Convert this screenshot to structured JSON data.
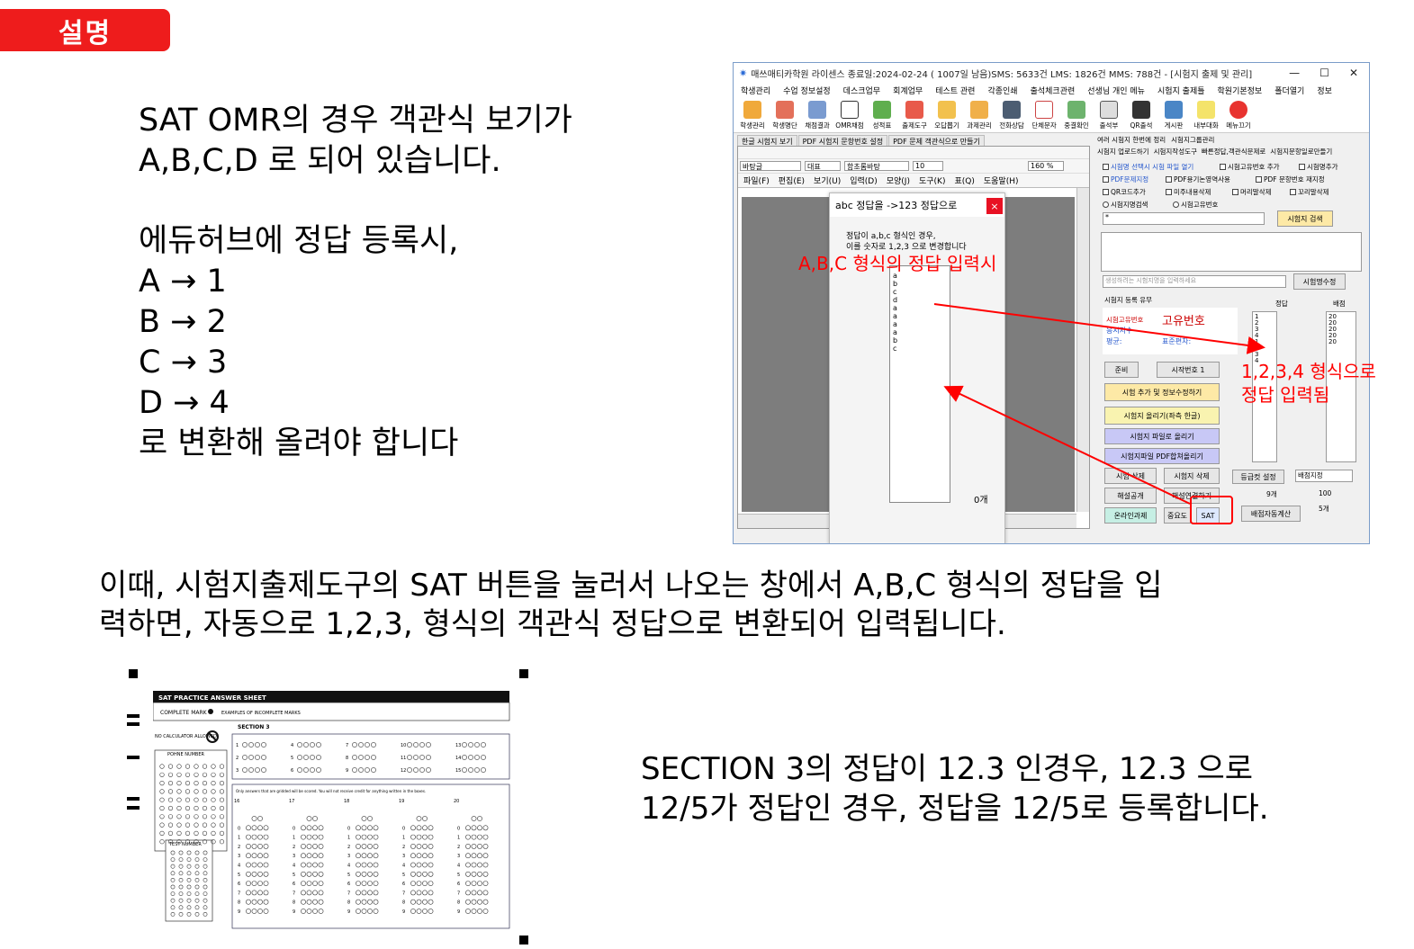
{
  "badge": "설명",
  "intro": {
    "line1": "SAT OMR의 경우 객관식 보기가",
    "line2": "A,B,C,D 로 되어 있습니다."
  },
  "mapping": {
    "line1": "에듀허브에 정답 등록시,",
    "a": "A → 1",
    "b": "B → 2",
    "c": "C → 3",
    "d": "D → 4",
    "line_end": "로 변환해 올려야 합니다"
  },
  "middle": {
    "line1": "이때, 시험지출제도구의 SAT 버튼을 눌러서 나오는 창에서 A,B,C 형식의 정답을 입",
    "line2": "력하면, 자동으로 1,2,3, 형식의 객관식 정답으로 변환되어 입력됩니다."
  },
  "section3": {
    "line1": "SECTION 3의 정답이 12.3 인경우, 12.3 으로",
    "line2": "12/5가 정답인 경우, 정답을 12/5로 등록합니다."
  },
  "annotations": {
    "abc_input": "A,B,C 형식의 정답 입력시",
    "num_input_1": "1,2,3,4 형식으로",
    "num_input_2": "정답 입력됨"
  },
  "window": {
    "title": "매쓰매티카학원  라이센스 종료일:2024-02-24 ( 1007일 남음)SMS: 5633건 LMS: 1826건 MMS: 788건  - [시험지 출제 및 관리]",
    "controls": [
      "—",
      "☐",
      "✕"
    ],
    "menu": [
      "학생관리",
      "수업 정보설정",
      "데스크업무",
      "회계업무",
      "테스트 관련",
      "각종인쇄",
      "출석체크관련",
      "선생님 개인 메뉴",
      "시험지 출제틀",
      "학원기본정보",
      "폴더열기",
      "정보"
    ],
    "toolbar": [
      "학생관리",
      "학생명단",
      "채점결과",
      "OMR채점",
      "성적표",
      "출제도구",
      "오답뽑기",
      "과제관리",
      "전화상담",
      "단체문자",
      "중결확인",
      "출석부",
      "QR출석",
      "게시판",
      "내부대화",
      "메뉴끄기"
    ],
    "doc_tabs": [
      "한글 시험지 보기",
      "PDF 시험지 문항번호 설정",
      "PDF 문제 객관식으로 만들기"
    ],
    "editor": {
      "style": "바탕글",
      "type": "대표",
      "font": "함초롬바탕",
      "size": "10",
      "zoom": "160 %",
      "menu": [
        "파일(F)",
        "편집(E)",
        "보기(U)",
        "입력(D)",
        "모양(J)",
        "도구(K)",
        "표(Q)",
        "도움말(H)"
      ]
    },
    "dialog": {
      "title": "abc 정답을 ->123 정답으로",
      "close": "×",
      "note1": "정답이 a,b,c 형식인 경우,",
      "note2": "이를 숫자로 1,2,3 으로 변경합니다",
      "answers": [
        "a",
        "b",
        "c",
        "d",
        "a",
        "a",
        "a",
        "a",
        "b",
        "c"
      ],
      "count": "0개"
    },
    "right": {
      "tabs1": [
        "여러 시험지 한번에 정리",
        "시험지그룹관리"
      ],
      "tabs2": [
        "시험지 업로드하기",
        "시험지작성도구",
        "빠른정답,객관식문제로",
        "시험지문항일로만들기"
      ],
      "checks": [
        "시험명 선택시 시험 파일 열기",
        "시험고유번호 추가",
        "시험명추가",
        "PDF문제지정",
        "PDF용기논영역사용",
        "PDF 문항번호 재지정",
        "QR코드추가",
        "미주내용삭제",
        "머리말삭제",
        "꼬리말삭제"
      ],
      "radios": [
        "시험지명검색",
        "시험고유번호"
      ],
      "search_btn": "시험지 검색",
      "search_value": "*",
      "name_placeholder": "생성하려는 시험지명을 입력하세요",
      "rename_btn": "시험명수정",
      "reg_label": "시험지 등록 유무",
      "answer_label": "정답",
      "score_label": "배점",
      "uid_label": "시험고유번호",
      "uid_value": "고유번호",
      "exam_label": "응시자수",
      "avg_label": "평균:",
      "std_label": "표준편차:",
      "ready_btn": "준비",
      "start_btn": "시작번호 1",
      "add_btn": "시험 추가 및 정보수정하기",
      "upload_btn": "시험지 올리기(좌측 한글)",
      "file_btn": "시험지 파일로 올리기",
      "pdf_btn": "시험지파일 PDF합쳐올리기",
      "del_exam_btn": "시험 삭제",
      "del_paper_btn": "시험지 삭제",
      "sol_pub_btn": "해설공개",
      "sol_add_btn": "해설연결하기",
      "online_btn": "온라인과제",
      "important_btn": "중요도",
      "sat_btn": "SAT",
      "grade_btn": "등급컷 설정",
      "score_select": "배점지정",
      "q_count": "9개",
      "score_total": "100",
      "five_count": "5개",
      "auto_btn": "배점자동계산",
      "answers": [
        "1",
        "2",
        "3",
        "4",
        "1",
        "2",
        "3",
        "4"
      ],
      "scores": [
        "20",
        "20",
        "20",
        "20",
        "20"
      ]
    }
  },
  "sheet": {
    "header": "SAT PRACTICE ANSWER SHEET",
    "complete": "COMPLETE MARK",
    "examples": "EXAMPLES OF INCOMPLETE MARKS",
    "section": "SECTION 3",
    "nocalc": "NO CALCULATOR ALLOWED",
    "phone": "POHNE NUMBER",
    "test": "TEST NUMBER",
    "grid_note": "Only answers that are gridded will be scored. You will not receive credit for anything written in the boxes.",
    "mc_numbers": [
      "1",
      "4",
      "7",
      "10",
      "13",
      "2",
      "5",
      "8",
      "11",
      "14",
      "3",
      "6",
      "9",
      "12",
      "15"
    ],
    "grid_numbers": [
      "16",
      "17",
      "18",
      "19",
      "20"
    ]
  },
  "colors": {
    "accent_red": "#ee1c1c",
    "annotation_red": "#ff0000"
  }
}
